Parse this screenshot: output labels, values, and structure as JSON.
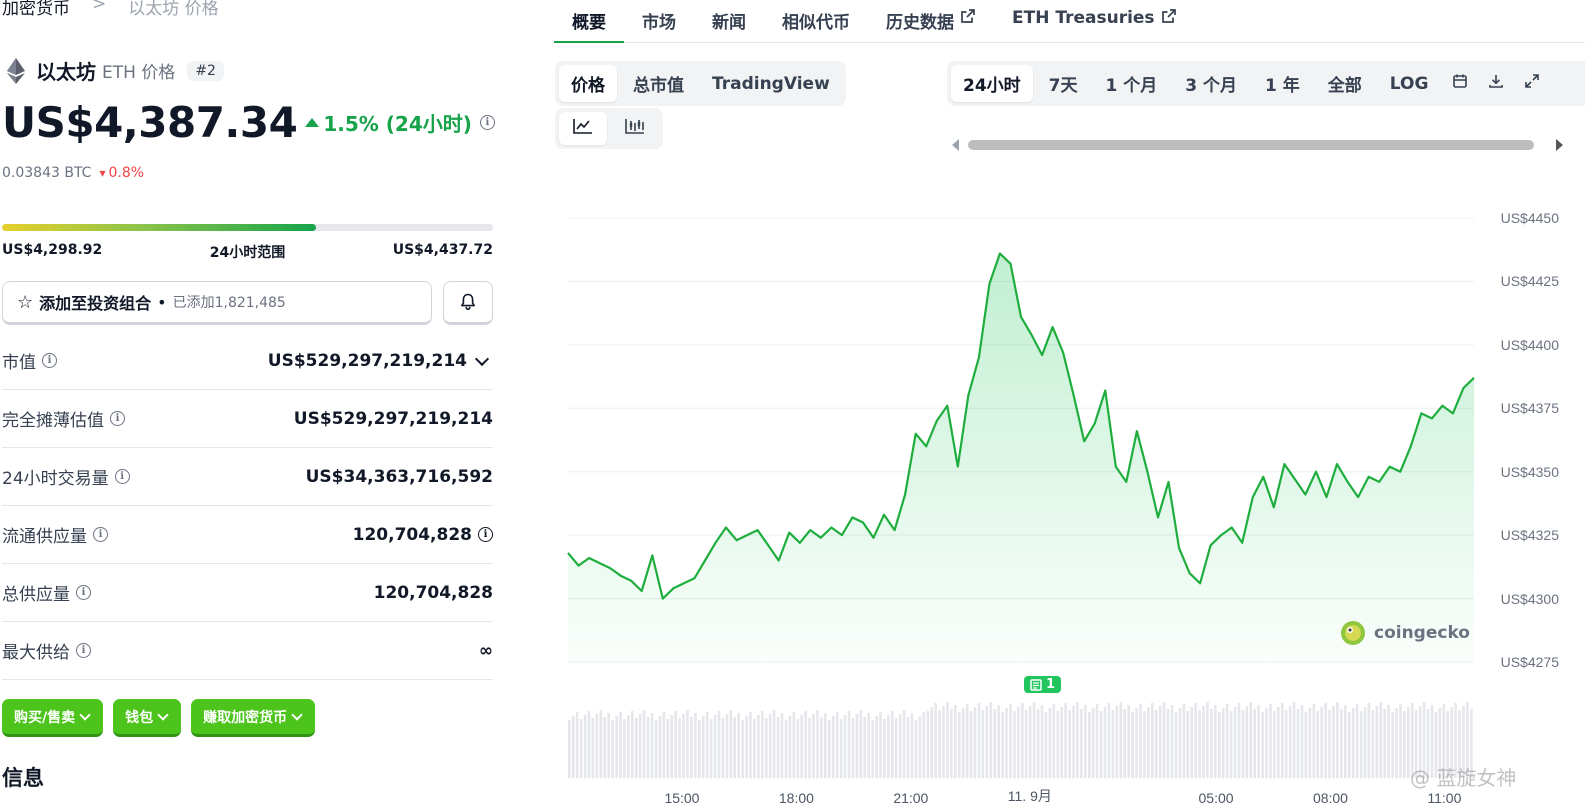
{
  "breadcrumb": {
    "root": "加密货币",
    "separator": ">",
    "current": "以太坊 价格"
  },
  "coin": {
    "name": "以太坊",
    "subtitle": "ETH 价格",
    "rank": "#2"
  },
  "price": {
    "value": "US$4,387.34",
    "change_24h": "1.5% (24小时)",
    "btc_value": "0.03843 BTC",
    "btc_change": "0.8%"
  },
  "range_24h": {
    "low": "US$4,298.92",
    "label": "24小时范围",
    "high": "US$4,437.72",
    "fill_fraction": 0.64
  },
  "portfolio": {
    "label": "添加至投资组合",
    "dot": "•",
    "count": "已添加1,821,485"
  },
  "stats": [
    {
      "label": "市值",
      "value": "US$529,297,219,214"
    },
    {
      "label": "完全摊薄估值",
      "value": "US$529,297,219,214"
    },
    {
      "label": "24小时交易量",
      "value": "US$34,363,716,592"
    },
    {
      "label": "流通供应量",
      "value": "120,704,828"
    },
    {
      "label": "总供应量",
      "value": "120,704,828"
    },
    {
      "label": "最大供给",
      "value": "∞"
    }
  ],
  "actions": [
    {
      "label": "购买/售卖"
    },
    {
      "label": "钱包"
    },
    {
      "label": "赚取加密货币"
    }
  ],
  "info_heading": "信息",
  "tabs": [
    {
      "label": "概要"
    },
    {
      "label": "市场"
    },
    {
      "label": "新闻"
    },
    {
      "label": "相似代币"
    },
    {
      "label": "历史数据"
    },
    {
      "label": "ETH Treasuries"
    }
  ],
  "chart_tabs": [
    {
      "label": "价格"
    },
    {
      "label": "总市值"
    },
    {
      "label": "TradingView"
    }
  ],
  "ranges": [
    {
      "label": "24小时"
    },
    {
      "label": "7天"
    },
    {
      "label": "1 个月"
    },
    {
      "label": "3 个月"
    },
    {
      "label": "1 年"
    },
    {
      "label": "全部"
    },
    {
      "label": "LOG"
    }
  ],
  "brand_logo": "coingecko",
  "news_count": "1",
  "watermark": "@ 蓝旋女神",
  "colors": {
    "accent": "#16a34a",
    "line": "#1fae3e",
    "button": "#4cc41c",
    "down": "#ef4444"
  },
  "chart_data": {
    "type": "area",
    "y_ticks": [
      "US$4450",
      "US$4425",
      "US$4400",
      "US$4375",
      "US$4350",
      "US$4325",
      "US$4300",
      "US$4275"
    ],
    "x_ticks": [
      "15:00",
      "18:00",
      "21:00",
      "11. 9月",
      "05:00",
      "08:00",
      "11:00"
    ],
    "ylim": [
      4275,
      4450
    ],
    "x_start_hour": 12.0,
    "x_end_hour": 35.75,
    "series": [
      {
        "values": [
          4318,
          4313,
          4316,
          4314,
          4312,
          4309,
          4307,
          4303,
          4317,
          4300,
          4304,
          4306,
          4308,
          4315,
          4322,
          4328,
          4323,
          4325,
          4327,
          4321,
          4315,
          4326,
          4322,
          4327,
          4324,
          4328,
          4325,
          4332,
          4330,
          4324,
          4333,
          4327,
          4341,
          4365,
          4360,
          4370,
          4376,
          4352,
          4380,
          4395,
          4424,
          4436,
          4432,
          4411,
          4404,
          4396,
          4407,
          4397,
          4380,
          4362,
          4369,
          4382,
          4352,
          4346,
          4366,
          4350,
          4332,
          4346,
          4320,
          4310,
          4306,
          4321,
          4325,
          4328,
          4322,
          4340,
          4348,
          4336,
          4353,
          4347,
          4341,
          4350,
          4340,
          4353,
          4346,
          4340,
          4348,
          4346,
          4352,
          4350,
          4360,
          4373,
          4371,
          4376,
          4373,
          4383,
          4387
        ]
      }
    ],
    "grid": true
  }
}
